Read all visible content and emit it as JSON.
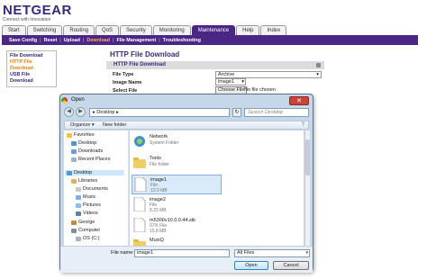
{
  "router": {
    "logo": "NETGEAR",
    "tagline": "Connect with Innovation",
    "main_tabs": [
      "Start",
      "Switching",
      "Routing",
      "QoS",
      "Security",
      "Monitoring",
      "Maintenance",
      "Help",
      "Index"
    ],
    "active_tab": "Maintenance",
    "sub_nav": [
      "Save Config",
      "Reset",
      "Upload",
      "Download",
      "File Management",
      "Troubleshooting"
    ],
    "active_sub": "Download",
    "left_menu": [
      "File Download",
      "HTTP File Download",
      "USB File Download"
    ],
    "active_left": "HTTP File Download",
    "page_title": "HTTP File Download",
    "section_title": "HTTP File Download",
    "form": {
      "file_type_label": "File Type",
      "file_type_value": "Archive",
      "image_name_label": "Image Name",
      "image_name_value": "image1",
      "select_file_label": "Select File",
      "choose_button": "Choose File",
      "no_file_text": "No file chosen"
    }
  },
  "dialog": {
    "title": "Open",
    "close_glyph": "✕",
    "back_glyph": "◀",
    "forward_glyph": "▶",
    "path": "▸ Desktop ▸",
    "refresh_glyph": "↻",
    "search_placeholder": "Search Desktop",
    "toolbar": {
      "organize": "Organize ▾",
      "new_folder": "New folder",
      "help_glyph": "?"
    },
    "nav_items": [
      {
        "label": "Favorites",
        "icon": "star-icon"
      },
      {
        "label": "Desktop",
        "icon": "desktop-icon"
      },
      {
        "label": "Downloads",
        "icon": "downloads-icon"
      },
      {
        "label": "Recent Places",
        "icon": "recent-places-icon"
      },
      {
        "label": "Desktop",
        "icon": "desktop-icon"
      },
      {
        "label": "Libraries",
        "icon": "libraries-icon"
      },
      {
        "label": "Documents",
        "icon": "documents-icon"
      },
      {
        "label": "Music",
        "icon": "music-icon"
      },
      {
        "label": "Pictures",
        "icon": "pictures-icon"
      },
      {
        "label": "Videos",
        "icon": "videos-icon"
      },
      {
        "label": "George",
        "icon": "user-icon"
      },
      {
        "label": "Computer",
        "icon": "computer-icon"
      },
      {
        "label": "OS (C:)",
        "icon": "drive-icon"
      }
    ],
    "selected_nav": 4,
    "files": [
      {
        "name": "Network",
        "line2": "System Folder",
        "line3": "",
        "icon": "network-icon"
      },
      {
        "name": "Tools",
        "line2": "File folder",
        "line3": "",
        "icon": "folder-icon"
      },
      {
        "name": "image1",
        "line2": "File",
        "line3": "13.0 MB",
        "icon": "file-icon"
      },
      {
        "name": "image2",
        "line2": "File",
        "line3": "8.25 MB",
        "icon": "file-icon"
      },
      {
        "name": "m5300v10.0.0.44.stk",
        "line2": "STK File",
        "line3": "15.8 MB",
        "icon": "file-icon"
      },
      {
        "name": "MusiQ",
        "line2": "",
        "line3": "",
        "icon": "folder-icon"
      }
    ],
    "selected_file": 2,
    "file_name_label": "File name:",
    "file_name_value": "image1",
    "file_type_filter": "All Files",
    "open_button": "Open",
    "cancel_button": "Cancel",
    "colors": {
      "accent": "#4b2785",
      "active_orange": "#e6820e",
      "selection": "#cce8ff"
    }
  }
}
